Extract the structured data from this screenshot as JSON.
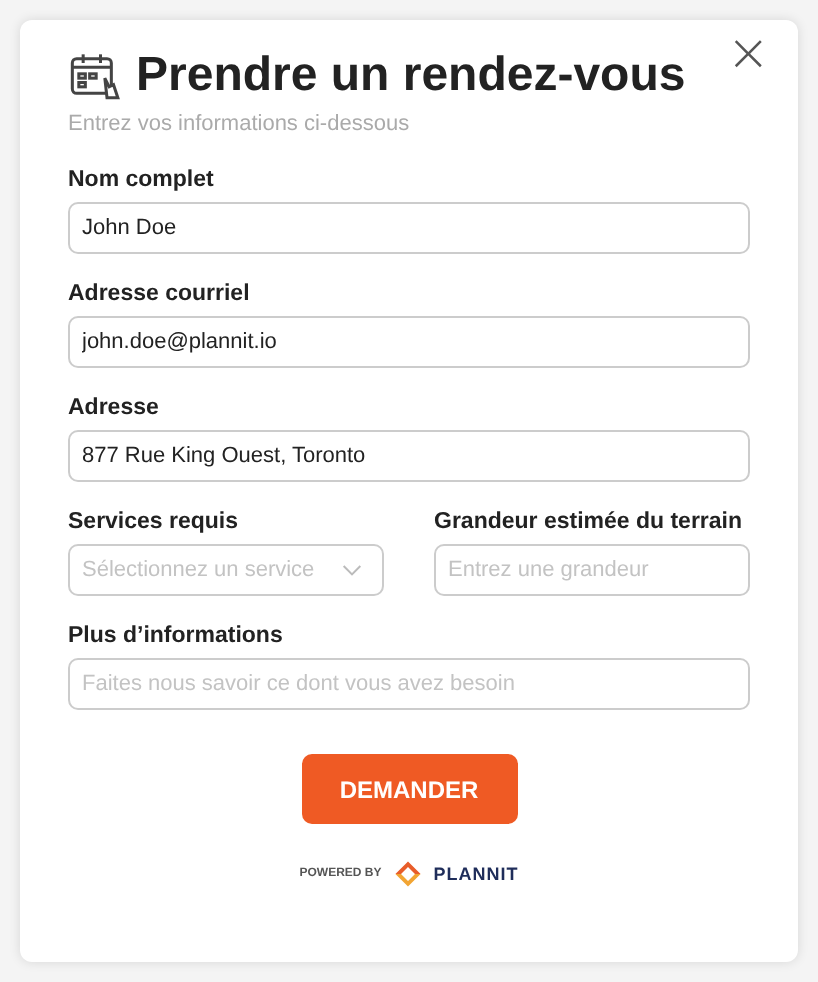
{
  "dialog": {
    "title": "Prendre un rendez-vous",
    "subtitle": "Entrez vos informations ci-dessous",
    "close": "×"
  },
  "fields": [
    {
      "label": "Nom complet",
      "kind": "text",
      "value": "John Doe"
    },
    {
      "label": "Adresse courriel",
      "kind": "text",
      "value": "john.doe@plannit.io"
    },
    {
      "label": "Adresse",
      "kind": "text",
      "value": "877 Rue King Ouest, Toronto"
    }
  ],
  "row_fields": [
    {
      "label": "Services requis",
      "kind": "select",
      "placeholder": "Sélectionnez un service"
    },
    {
      "label": "Grandeur estimée du terrain",
      "kind": "text",
      "placeholder": "Entrez une grandeur"
    }
  ],
  "more": {
    "label": "Plus d’informations",
    "kind": "text",
    "placeholder": "Faites nous savoir ce dont vous avez besoin"
  },
  "submit": "DEMANDER",
  "footer": {
    "powered_by": "POWERED BY",
    "brand": "PLANNIT"
  }
}
